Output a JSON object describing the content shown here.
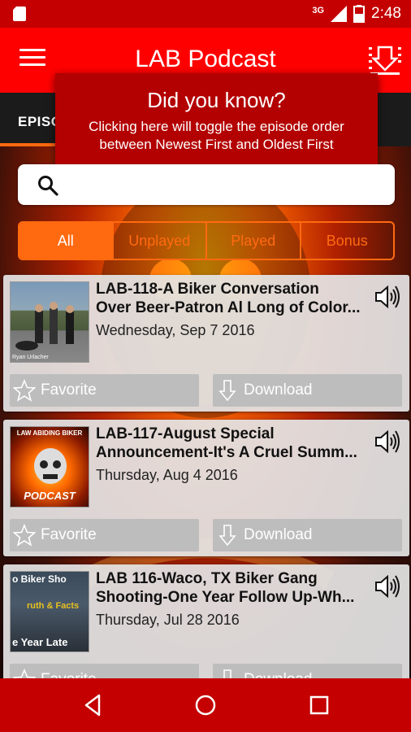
{
  "status_bar": {
    "network": "3G",
    "time": "2:48"
  },
  "app": {
    "title": "LAB Podcast"
  },
  "tab": {
    "label": "EPISO"
  },
  "tooltip": {
    "title": "Did you know?",
    "body": "Clicking here will toggle the episode order between Newest First and Oldest First"
  },
  "search": {
    "placeholder": ""
  },
  "filters": [
    "All",
    "Unplayed",
    "Played",
    "Bonus"
  ],
  "episodes": [
    {
      "title_line1": "LAB-118-A Biker Conversation",
      "title_line2": "Over Beer-Patron Al Long of Color...",
      "date": "Wednesday, Sep 7 2016",
      "thumb_caption": "Ryan Urlacher"
    },
    {
      "title_line1": "LAB-117-August Special",
      "title_line2": "Announcement-It's A Cruel Summ...",
      "date": "Thursday, Aug 4 2016",
      "thumb_top": "LAW ABIDING BIKER",
      "thumb_bottom": "PODCAST"
    },
    {
      "title_line1": "LAB 116-Waco, TX Biker Gang",
      "title_line2": "Shooting-One Year Follow Up-Wh...",
      "date": "Thursday, Jul 28 2016",
      "thumb_top": "o Biker Sho",
      "thumb_mid": "ruth & Facts",
      "thumb_bottom": "e Year Late"
    }
  ],
  "actions": {
    "favorite": "Favorite",
    "download": "Download"
  },
  "colors": {
    "status": "#c40000",
    "appbar": "#ff0000",
    "accent": "#ff6a10",
    "tooltip": "#b30000"
  }
}
